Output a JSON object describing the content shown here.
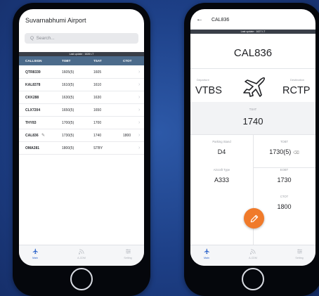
{
  "list_screen": {
    "title": "Suvarnabhumi Airport",
    "search": {
      "placeholder": "Q  Search...",
      "value": ""
    },
    "last_update": "Last update : 1626 LT",
    "columns": [
      "CALLSIGN",
      "TOBT",
      "TSAT",
      "CTOT"
    ],
    "rows": [
      {
        "callsign": "QTR8339",
        "tobt": "1605(5)",
        "tsat": "1605",
        "ctot": ""
      },
      {
        "callsign": "KAL8378",
        "tobt": "1610(5)",
        "tsat": "1610",
        "ctot": ""
      },
      {
        "callsign": "CKK288",
        "tobt": "1630(5)",
        "tsat": "1630",
        "ctot": ""
      },
      {
        "callsign": "CLX7204",
        "tobt": "1650(5)",
        "tsat": "1650",
        "ctot": ""
      },
      {
        "callsign": "THY83",
        "tobt": "1700(5)",
        "tsat": "1700",
        "ctot": ""
      },
      {
        "callsign": "CAL836",
        "tobt": "1730(5)",
        "tsat": "1740",
        "ctot": "1800"
      },
      {
        "callsign": "OMA281",
        "tobt": "1800(5)",
        "tsat": "STBY",
        "ctot": ""
      }
    ],
    "tabs": [
      {
        "label": "Main",
        "icon": "plane-icon",
        "active": true
      },
      {
        "label": "A-CDM",
        "icon": "signal-icon",
        "active": false
      },
      {
        "label": "Setting",
        "icon": "sliders-icon",
        "active": false
      }
    ]
  },
  "detail_screen": {
    "header_title": "CAL836",
    "last_update": "Last update : 1627 LT",
    "callsign": "CAL836",
    "departure_label": "Departure",
    "departure": "VTBS",
    "destination_label": "Destination",
    "destination": "RCTP",
    "tsat_label": "TSAT",
    "tsat": "1740",
    "parking_stand_label": "Parking Stand",
    "parking_stand": "D4",
    "aircraft_type_label": "Aircraft Type",
    "aircraft_type": "A333",
    "tobt_label": "TOBT",
    "tobt": "1730(5)",
    "eobt_label": "EOBT",
    "eobt": "1730",
    "ctot_label": "CTOT",
    "ctot": "1800",
    "tabs": [
      {
        "label": "Main",
        "icon": "plane-icon",
        "active": true
      },
      {
        "label": "A-CDM",
        "icon": "signal-icon",
        "active": false
      },
      {
        "label": "Setting",
        "icon": "sliders-icon",
        "active": false
      }
    ]
  },
  "colors": {
    "accent": "#2a62c9",
    "table_header": "#4c6b8b",
    "fab": "#f07a2a",
    "background": "#1d3f86"
  }
}
